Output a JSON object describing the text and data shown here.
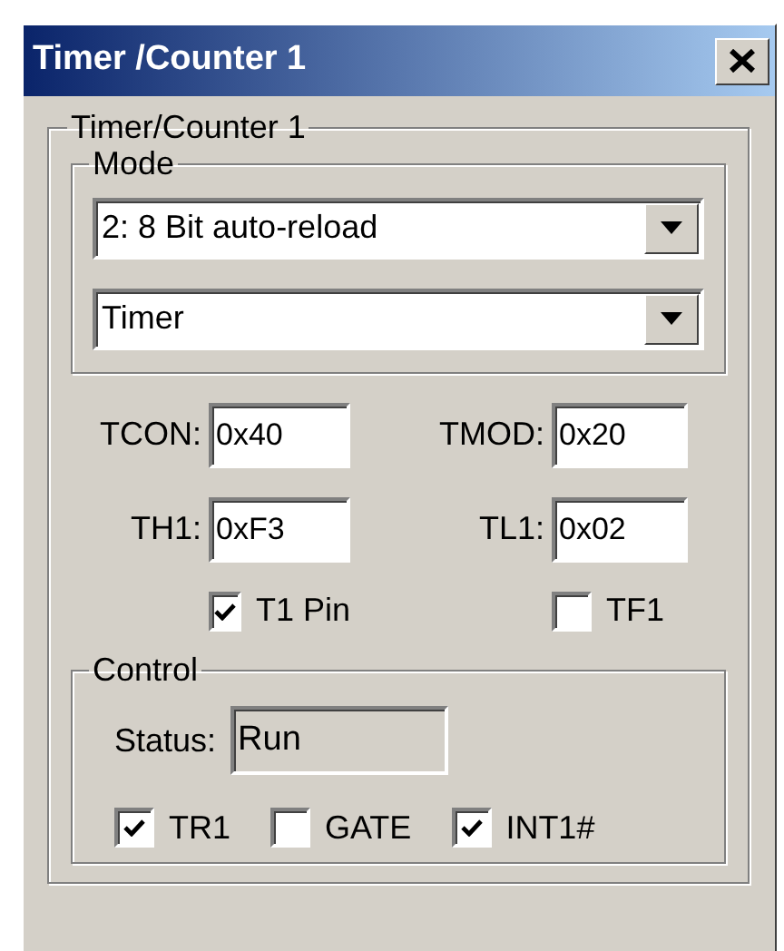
{
  "window": {
    "title": "Timer /Counter 1"
  },
  "group": {
    "title": "Timer/Counter 1"
  },
  "mode": {
    "title": "Mode",
    "dropdowns": [
      {
        "value": "2: 8 Bit auto-reload"
      },
      {
        "value": "Timer"
      }
    ]
  },
  "registers": [
    {
      "label": "TCON:",
      "value": "0x40"
    },
    {
      "label": "TMOD:",
      "value": "0x20"
    },
    {
      "label": "TH1:",
      "value": "0xF3"
    },
    {
      "label": "TL1:",
      "value": "0x02"
    }
  ],
  "flags": [
    {
      "label": "T1 Pin",
      "checked": true
    },
    {
      "label": "TF1",
      "checked": false
    }
  ],
  "control": {
    "title": "Control",
    "status_label": "Status:",
    "status_value": "Run",
    "checkboxes": [
      {
        "label": "TR1",
        "checked": true
      },
      {
        "label": "GATE",
        "checked": false
      },
      {
        "label": "INT1#",
        "checked": true
      }
    ]
  }
}
